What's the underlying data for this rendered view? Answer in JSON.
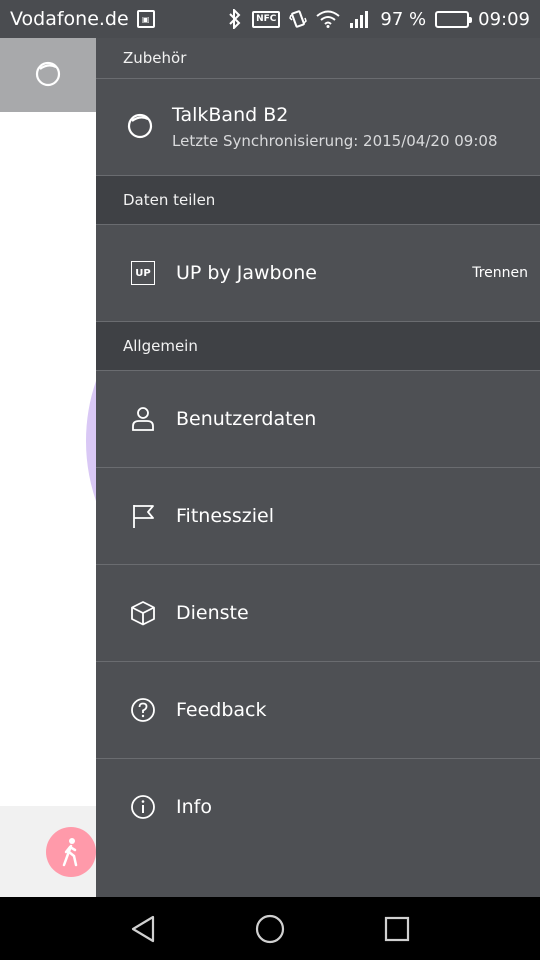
{
  "status_bar": {
    "carrier": "Vodafone.de",
    "nfc": "NFC",
    "battery": "97 %",
    "battery_level": 0.97,
    "time": "09:09"
  },
  "drawer": {
    "sections": {
      "accessories": "Zubehör",
      "share": "Daten teilen",
      "general": "Allgemein"
    },
    "device": {
      "name": "TalkBand B2",
      "sync": "Letzte Synchronisierung: 2015/04/20 09:08"
    },
    "share_item": {
      "badge": "UP",
      "label": "UP by Jawbone",
      "action": "Trennen"
    },
    "items": [
      {
        "label": "Benutzerdaten",
        "icon": "person-icon"
      },
      {
        "label": "Fitnessziel",
        "icon": "flag-icon"
      },
      {
        "label": "Dienste",
        "icon": "cube-icon"
      },
      {
        "label": "Feedback",
        "icon": "question-icon"
      },
      {
        "label": "Info",
        "icon": "info-icon"
      }
    ]
  },
  "colors": {
    "drawer_bg": "#4e5054",
    "section_bg": "#3f4145",
    "status_bg": "#4a4c50",
    "accent_pink": "#ff9aaa"
  }
}
